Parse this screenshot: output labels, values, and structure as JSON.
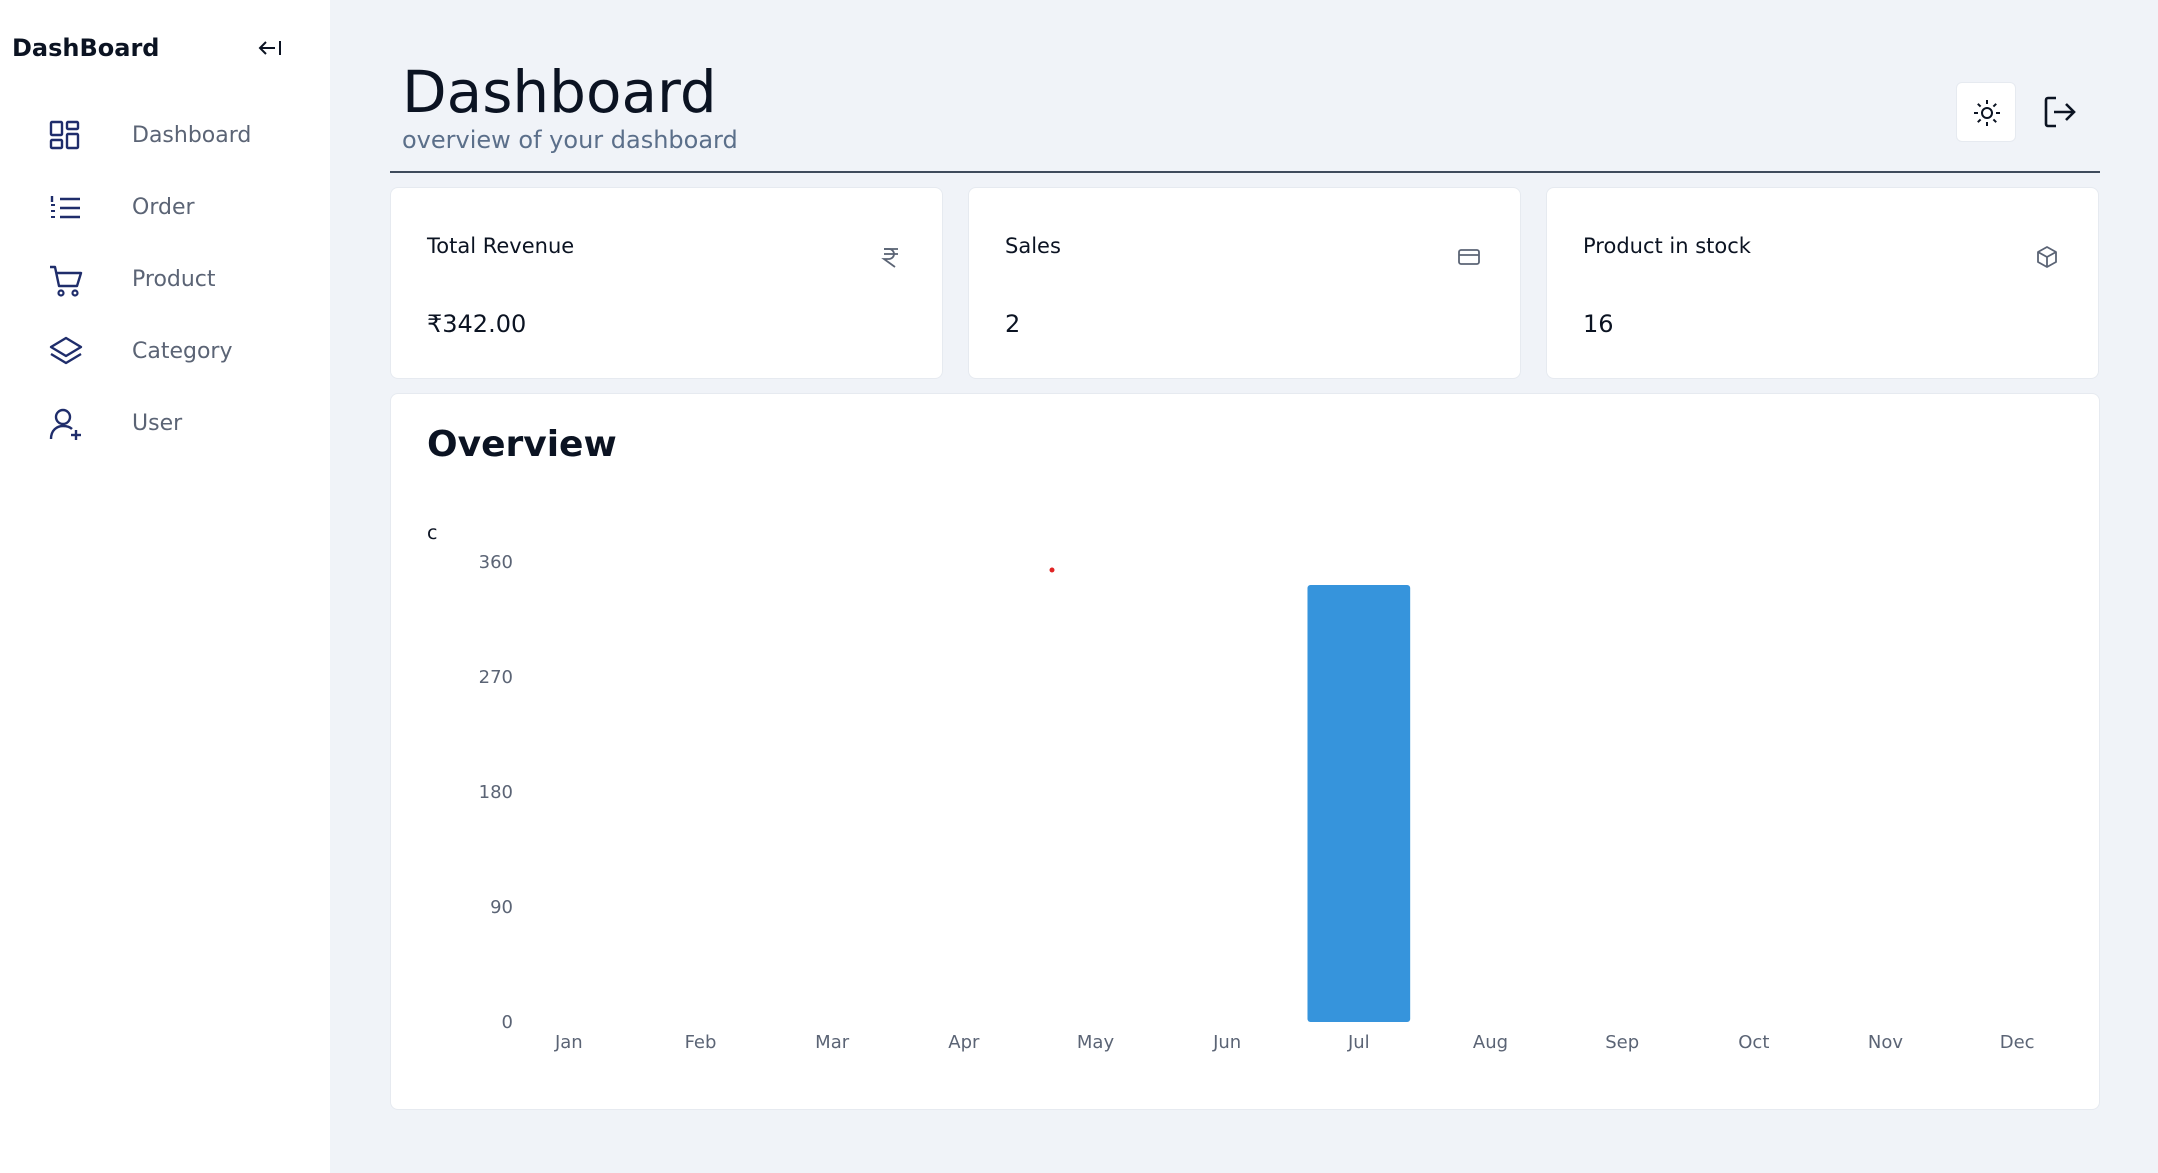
{
  "sidebar": {
    "brand": "DashBoard",
    "items": [
      {
        "label": "Dashboard",
        "icon": "dashboard-grid-icon"
      },
      {
        "label": "Order",
        "icon": "list-icon"
      },
      {
        "label": "Product",
        "icon": "cart-icon"
      },
      {
        "label": "Category",
        "icon": "layers-icon"
      },
      {
        "label": "User",
        "icon": "user-plus-icon"
      }
    ]
  },
  "header": {
    "title": "Dashboard",
    "subtitle": "overview of your dashboard"
  },
  "cards": [
    {
      "title": "Total Revenue",
      "value": "₹342.00",
      "icon": "rupee-icon"
    },
    {
      "title": "Sales",
      "value": "2",
      "icon": "credit-card-icon"
    },
    {
      "title": "Product in stock",
      "value": "16",
      "icon": "box-icon"
    }
  ],
  "overview": {
    "title": "Overview",
    "stray_label": "c"
  },
  "colors": {
    "accent": "#3694dc",
    "sidebar_icon": "#1f2d6b",
    "background": "#f0f3f8"
  },
  "chart_data": {
    "type": "bar",
    "categories": [
      "Jan",
      "Feb",
      "Mar",
      "Apr",
      "May",
      "Jun",
      "Jul",
      "Aug",
      "Sep",
      "Oct",
      "Nov",
      "Dec"
    ],
    "values": [
      0,
      0,
      0,
      0,
      0,
      0,
      342,
      0,
      0,
      0,
      0,
      0
    ],
    "yticks": [
      0,
      90,
      180,
      270,
      360
    ],
    "ylim": [
      0,
      360
    ],
    "grid": false,
    "color": "#3694dc"
  }
}
